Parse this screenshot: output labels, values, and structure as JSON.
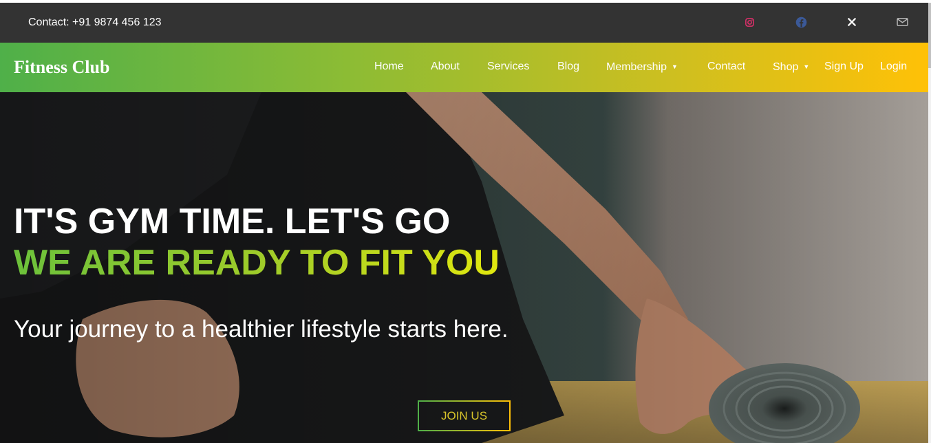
{
  "topbar": {
    "contact": "Contact: +91 9874 456 123",
    "social": [
      {
        "icon": "instagram-icon",
        "color": "#e1306c"
      },
      {
        "icon": "facebook-icon",
        "color": "#3b5998"
      },
      {
        "icon": "x-icon",
        "color": "#ffffff"
      },
      {
        "icon": "mail-icon",
        "color": "#bbbbbb"
      }
    ]
  },
  "nav": {
    "brand": "Fitness Club",
    "items": {
      "home": "Home",
      "about": "About",
      "services": "Services",
      "blog": "Blog",
      "membership": "Membership",
      "contact": "Contact",
      "shop": "Shop",
      "signup": "Sign Up",
      "login": "Login"
    },
    "gradient_start": "#4fb049",
    "gradient_end": "#ffc107"
  },
  "hero": {
    "title_line1": "IT'S GYM TIME. LET'S GO",
    "title_line2": "WE ARE READY TO FIT YOU",
    "subtitle": "Your journey to a healthier lifestyle starts here.",
    "cta": "JOIN US"
  },
  "colors": {
    "topbar_bg": "#333333",
    "accent_green": "#6cc13b",
    "accent_yellow": "#e1e80f"
  }
}
